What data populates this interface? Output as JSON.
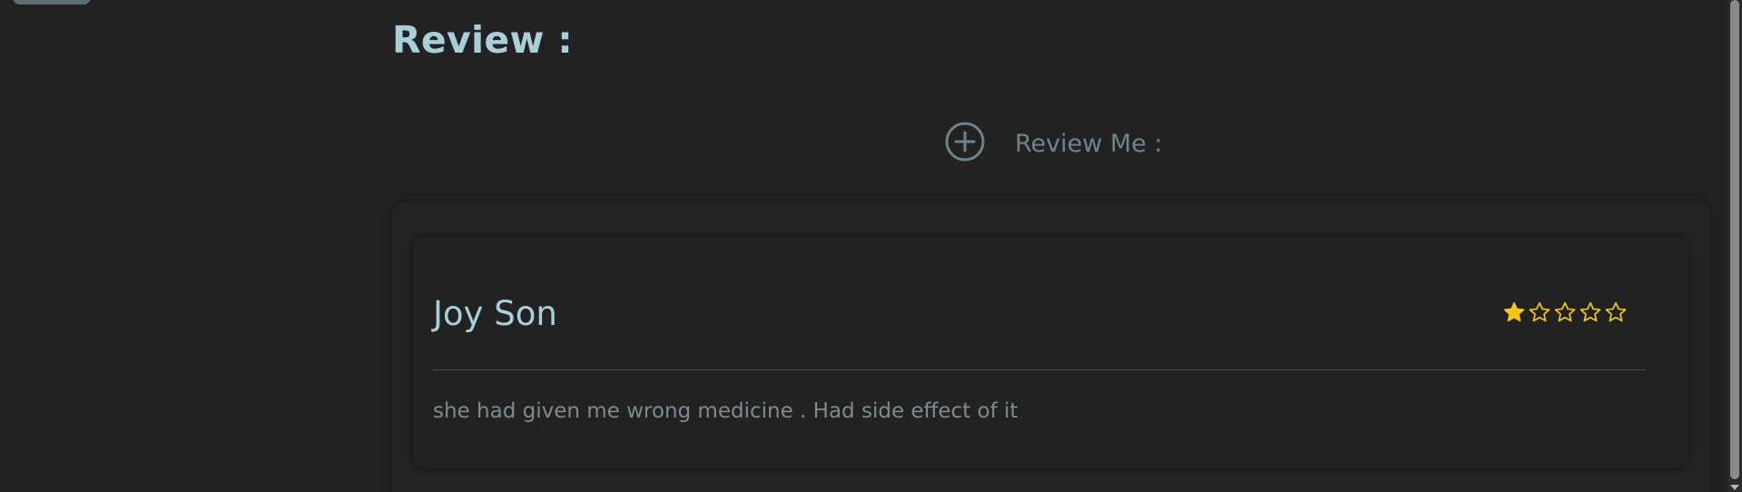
{
  "section": {
    "title": "Review :"
  },
  "review_me": {
    "label": "Review Me :",
    "icon": "plus-circle-icon"
  },
  "colors": {
    "background": "#222222",
    "title": "#a9cfd8",
    "muted": "#6f8489",
    "star": "#f5c518"
  },
  "reviews": [
    {
      "name": "Joy Son",
      "rating": 1,
      "max_rating": 5,
      "text": "she had given me wrong medicine . Had side effect of it"
    }
  ]
}
